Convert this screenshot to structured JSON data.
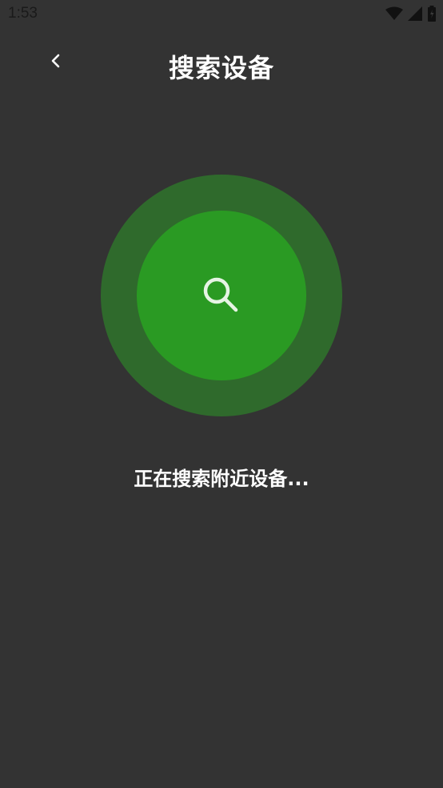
{
  "status_bar": {
    "time": "1:53",
    "icons": [
      "wifi-icon",
      "cellular-signal-icon",
      "battery-icon"
    ]
  },
  "header": {
    "back_icon": "chevron-left-icon",
    "title": "搜索设备"
  },
  "scanner": {
    "icon": "search-icon",
    "outer_color": "#2f6a2c",
    "inner_color": "#2a9a23",
    "message": "正在搜索附近设备..."
  }
}
